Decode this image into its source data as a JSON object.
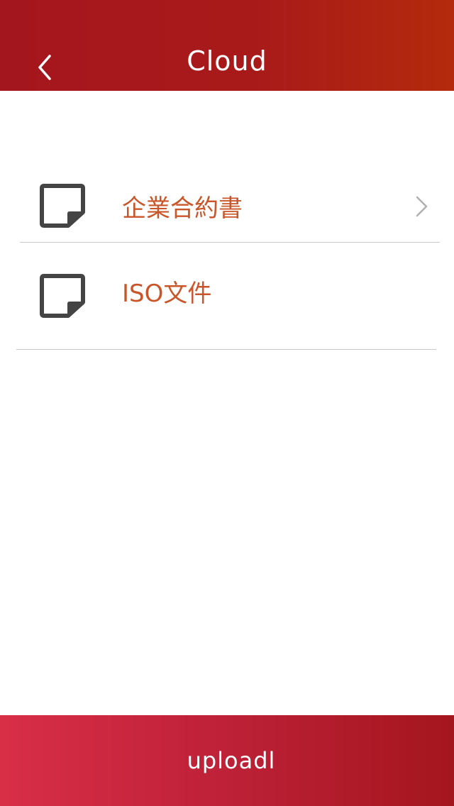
{
  "header": {
    "title": "Cloud",
    "back_icon": "chevron-left-icon"
  },
  "colors": {
    "header": "#a81a1a",
    "accent_text": "#c9562a",
    "footer_start": "#d92e47",
    "footer_end": "#a4161d",
    "icon": "#444444",
    "divider": "#c9c9c9"
  },
  "list": {
    "items": [
      {
        "label": "企業合約書",
        "icon": "note-icon",
        "has_chevron": true
      },
      {
        "label": "ISO文件",
        "icon": "note-icon",
        "has_chevron": false
      }
    ]
  },
  "footer": {
    "upload_label": "uploadl"
  }
}
